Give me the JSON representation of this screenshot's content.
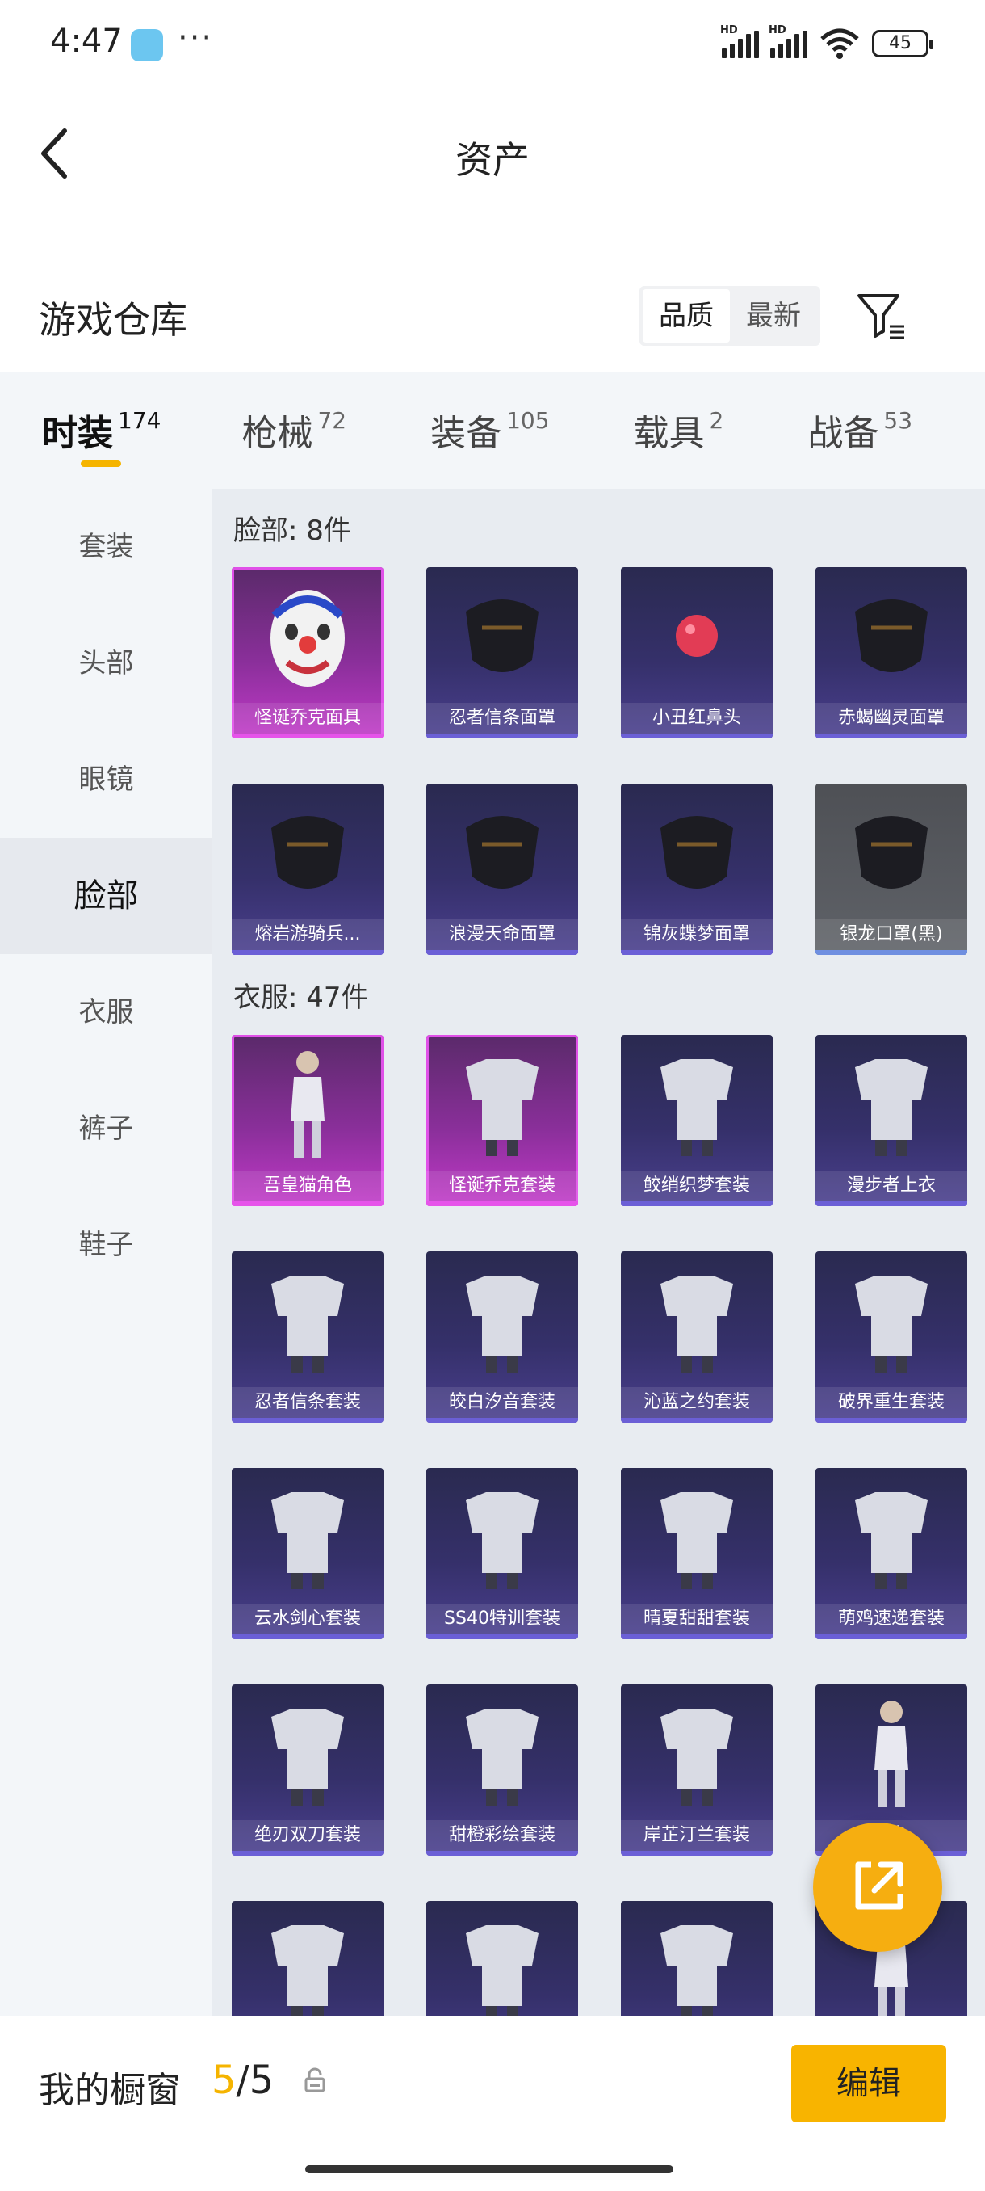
{
  "status_bar": {
    "time": "4:47",
    "more": "···",
    "battery": "45"
  },
  "nav": {
    "title": "资产"
  },
  "subheader": {
    "title": "游戏仓库",
    "sort_options": [
      {
        "label": "品质",
        "active": true
      },
      {
        "label": "最新",
        "active": false
      }
    ]
  },
  "tabs": [
    {
      "label": "时装",
      "count": "174",
      "active": true
    },
    {
      "label": "枪械",
      "count": "72",
      "active": false
    },
    {
      "label": "装备",
      "count": "105",
      "active": false
    },
    {
      "label": "载具",
      "count": "2",
      "active": false
    },
    {
      "label": "战备",
      "count": "53",
      "active": false
    }
  ],
  "sidebar": {
    "items": [
      {
        "label": "套装",
        "active": false
      },
      {
        "label": "头部",
        "active": false
      },
      {
        "label": "眼镜",
        "active": false
      },
      {
        "label": "脸部",
        "active": true
      },
      {
        "label": "衣服",
        "active": false
      },
      {
        "label": "裤子",
        "active": false
      },
      {
        "label": "鞋子",
        "active": false
      }
    ]
  },
  "sections": [
    {
      "title": "脸部: 8件",
      "items": [
        {
          "name": "怪诞乔克面具",
          "rarity": "pink",
          "icon": "clown-mask-icon"
        },
        {
          "name": "忍者信条面罩",
          "rarity": "purple",
          "icon": "ninja-mask-icon"
        },
        {
          "name": "小丑红鼻头",
          "rarity": "purple",
          "icon": "red-nose-icon"
        },
        {
          "name": "赤蝎幽灵面罩",
          "rarity": "purple",
          "icon": "scorpion-mask-icon"
        },
        {
          "name": "熔岩游骑兵...",
          "rarity": "purple",
          "icon": "ranger-mask-icon"
        },
        {
          "name": "浪漫天命面罩",
          "rarity": "purple",
          "icon": "romance-mask-icon"
        },
        {
          "name": "锦灰蝶梦面罩",
          "rarity": "purple",
          "icon": "butterfly-mask-icon"
        },
        {
          "name": "银龙口罩(黑)",
          "rarity": "gray",
          "icon": "dragon-facemask-icon"
        }
      ]
    },
    {
      "title": "衣服: 47件",
      "items": [
        {
          "name": "吾皇猫角色",
          "rarity": "pink",
          "icon": "cat-character-icon"
        },
        {
          "name": "怪诞乔克套装",
          "rarity": "pink",
          "icon": "joker-outfit-icon"
        },
        {
          "name": "鲛绡织梦套装",
          "rarity": "purple",
          "icon": "dream-outfit-icon"
        },
        {
          "name": "漫步者上衣",
          "rarity": "purple",
          "icon": "jacket-icon"
        },
        {
          "name": "忍者信条套装",
          "rarity": "purple",
          "icon": "ninja-outfit-icon"
        },
        {
          "name": "皎白汐音套装",
          "rarity": "purple",
          "icon": "white-outfit-icon"
        },
        {
          "name": "沁蓝之约套装",
          "rarity": "purple",
          "icon": "blue-outfit-icon"
        },
        {
          "name": "破界重生套装",
          "rarity": "purple",
          "icon": "rebirth-outfit-icon"
        },
        {
          "name": "云水剑心套装",
          "rarity": "purple",
          "icon": "sword-outfit-icon"
        },
        {
          "name": "SS40特训套装",
          "rarity": "purple",
          "icon": "training-outfit-icon"
        },
        {
          "name": "晴夏甜甜套装",
          "rarity": "purple",
          "icon": "summer-outfit-icon"
        },
        {
          "name": "萌鸡速递套装",
          "rarity": "purple",
          "icon": "chicken-outfit-icon"
        },
        {
          "name": "绝刃双刀套装",
          "rarity": "purple",
          "icon": "blade-outfit-icon"
        },
        {
          "name": "甜橙彩绘套装",
          "rarity": "purple",
          "icon": "orange-outfit-icon"
        },
        {
          "name": "岸芷汀兰套装",
          "rarity": "purple",
          "icon": "orchid-outfit-icon"
        },
        {
          "name": "角色",
          "rarity": "purple",
          "icon": "fairy-character-icon"
        },
        {
          "name": "",
          "rarity": "purple",
          "icon": "hoodie-icon"
        },
        {
          "name": "",
          "rarity": "purple",
          "icon": "outfit-icon"
        },
        {
          "name": "",
          "rarity": "purple",
          "icon": "outfit-icon"
        },
        {
          "name": "",
          "rarity": "purple",
          "icon": "frog-character-icon"
        }
      ]
    }
  ],
  "bottom_bar": {
    "label": "我的橱窗",
    "current": "5",
    "total": "/5",
    "edit_label": "编辑"
  },
  "colors": {
    "accent": "#f5b400",
    "fab": "#f6ae10",
    "pink_rarity": "#c13ac8",
    "purple_rarity": "#4a3f8e"
  }
}
